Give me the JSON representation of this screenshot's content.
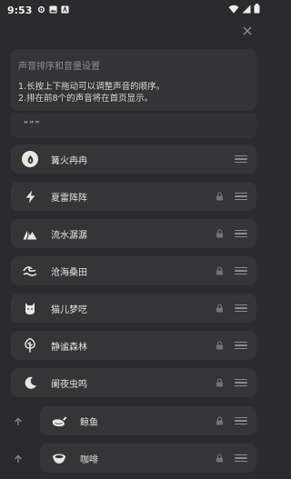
{
  "status_bar": {
    "time": "9:53"
  },
  "info": {
    "title": "声音排序和音量设置",
    "lines": [
      "1.长按上下拖动可以调整声音的顺序。",
      "2.排在前8个的声音将在首页显示。"
    ]
  },
  "partial_row": {
    "label": "“””"
  },
  "sounds": [
    {
      "label": "篝火冉冉",
      "icon": "flame-icon",
      "locked": false
    },
    {
      "label": "夏雷阵阵",
      "icon": "lightning-icon",
      "locked": true
    },
    {
      "label": "流水潺潺",
      "icon": "mountain-stream-icon",
      "locked": true
    },
    {
      "label": "沧海桑田",
      "icon": "wave-icon",
      "locked": true
    },
    {
      "label": "猫儿梦呓",
      "icon": "cat-icon",
      "locked": true
    },
    {
      "label": "静谧森林",
      "icon": "tree-icon",
      "locked": true
    },
    {
      "label": "阑夜虫鸣",
      "icon": "moon-icon",
      "locked": true
    },
    {
      "label": "鲸鱼",
      "icon": "whale-icon",
      "locked": true
    },
    {
      "label": "咖啡",
      "icon": "coffee-icon",
      "locked": true
    }
  ],
  "colors": {
    "background": "#2b2b2d",
    "card": "#353437",
    "icon_circle": "#ece5df"
  }
}
